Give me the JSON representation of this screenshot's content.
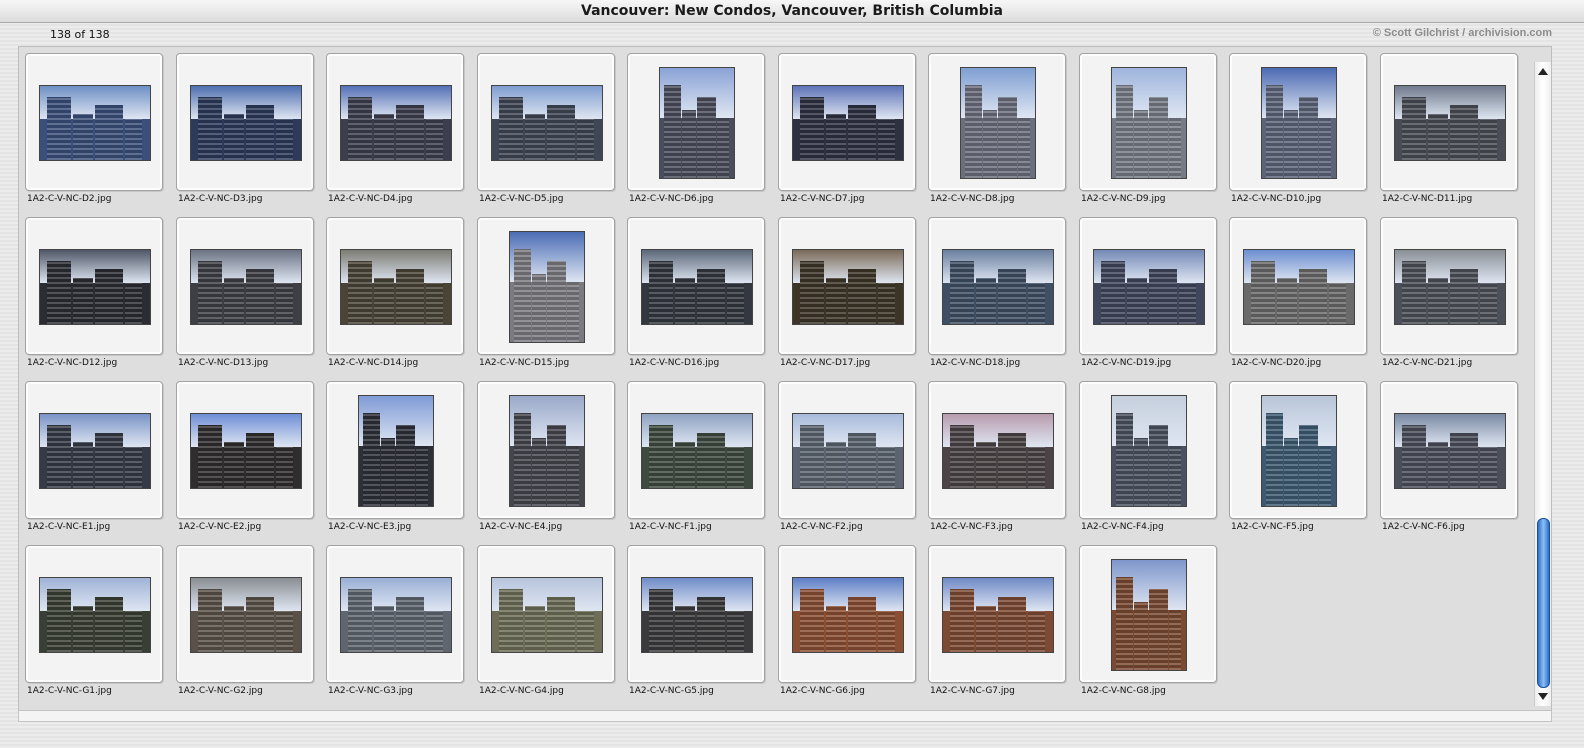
{
  "window": {
    "title": "Vancouver: New Condos, Vancouver, British Columbia"
  },
  "header": {
    "count": "138 of 138",
    "credit": "© Scott Gilchrist / archivision.com"
  },
  "items": [
    {
      "label": "1A2-C-V-NC-D2.jpg",
      "orientation": "landscape",
      "sky": "#6d8fc4",
      "tone": "#3a4f7a"
    },
    {
      "label": "1A2-C-V-NC-D3.jpg",
      "orientation": "landscape",
      "sky": "#4d6fb0",
      "tone": "#2d3a5a"
    },
    {
      "label": "1A2-C-V-NC-D4.jpg",
      "orientation": "landscape",
      "sky": "#5470b5",
      "tone": "#3c3e4e"
    },
    {
      "label": "1A2-C-V-NC-D5.jpg",
      "orientation": "landscape",
      "sky": "#7f9dd0",
      "tone": "#3f4654"
    },
    {
      "label": "1A2-C-V-NC-D6.jpg",
      "orientation": "portrait",
      "sky": "#8aa3d6",
      "tone": "#4a4e5c"
    },
    {
      "label": "1A2-C-V-NC-D7.jpg",
      "orientation": "landscape",
      "sky": "#5d73b8",
      "tone": "#2e3142"
    },
    {
      "label": "1A2-C-V-NC-D8.jpg",
      "orientation": "portrait",
      "sky": "#7f9fd2",
      "tone": "#6b6f7c"
    },
    {
      "label": "1A2-C-V-NC-D9.jpg",
      "orientation": "portrait",
      "sky": "#9eb4dd",
      "tone": "#767b86"
    },
    {
      "label": "1A2-C-V-NC-D10.jpg",
      "orientation": "portrait",
      "sky": "#4d6bb3",
      "tone": "#5c6479"
    },
    {
      "label": "1A2-C-V-NC-D11.jpg",
      "orientation": "landscape",
      "sky": "#6f7a8c",
      "tone": "#494c55"
    },
    {
      "label": "1A2-C-V-NC-D12.jpg",
      "orientation": "landscape",
      "sky": "#4f5768",
      "tone": "#2b2d33"
    },
    {
      "label": "1A2-C-V-NC-D13.jpg",
      "orientation": "landscape",
      "sky": "#6b7283",
      "tone": "#3d3f45"
    },
    {
      "label": "1A2-C-V-NC-D14.jpg",
      "orientation": "landscape",
      "sky": "#7d7c74",
      "tone": "#4a4437"
    },
    {
      "label": "1A2-C-V-NC-D15.jpg",
      "orientation": "portrait",
      "sky": "#4b6db4",
      "tone": "#7a7a80"
    },
    {
      "label": "1A2-C-V-NC-D16.jpg",
      "orientation": "landscape",
      "sky": "#5b6778",
      "tone": "#33373f"
    },
    {
      "label": "1A2-C-V-NC-D17.jpg",
      "orientation": "landscape",
      "sky": "#7a6a58",
      "tone": "#3c3528"
    },
    {
      "label": "1A2-C-V-NC-D18.jpg",
      "orientation": "landscape",
      "sky": "#6a7f9f",
      "tone": "#3f4f64"
    },
    {
      "label": "1A2-C-V-NC-D19.jpg",
      "orientation": "landscape",
      "sky": "#7489b6",
      "tone": "#40475c"
    },
    {
      "label": "1A2-C-V-NC-D20.jpg",
      "orientation": "landscape",
      "sky": "#6d8fd0",
      "tone": "#6a6a6a"
    },
    {
      "label": "1A2-C-V-NC-D21.jpg",
      "orientation": "landscape",
      "sky": "#8a8f96",
      "tone": "#4c5058"
    },
    {
      "label": "1A2-C-V-NC-E1.jpg",
      "orientation": "landscape",
      "sky": "#7a93c6",
      "tone": "#353a46"
    },
    {
      "label": "1A2-C-V-NC-E2.jpg",
      "orientation": "landscape",
      "sky": "#6f8fd6",
      "tone": "#2f2d2d"
    },
    {
      "label": "1A2-C-V-NC-E3.jpg",
      "orientation": "portrait",
      "sky": "#7f9bd6",
      "tone": "#2e3038"
    },
    {
      "label": "1A2-C-V-NC-E4.jpg",
      "orientation": "portrait",
      "sky": "#9aa9c9",
      "tone": "#44464e"
    },
    {
      "label": "1A2-C-V-NC-F1.jpg",
      "orientation": "landscape",
      "sky": "#8fa3c2",
      "tone": "#3e4a3f"
    },
    {
      "label": "1A2-C-V-NC-F2.jpg",
      "orientation": "landscape",
      "sky": "#a8bbdc",
      "tone": "#5b6470"
    },
    {
      "label": "1A2-C-V-NC-F3.jpg",
      "orientation": "landscape",
      "sky": "#b79cae",
      "tone": "#4b4345"
    },
    {
      "label": "1A2-C-V-NC-F4.jpg",
      "orientation": "portrait",
      "sky": "#c6cfdd",
      "tone": "#4b5160"
    },
    {
      "label": "1A2-C-V-NC-F5.jpg",
      "orientation": "portrait",
      "sky": "#b9c6d9",
      "tone": "#3e5a72"
    },
    {
      "label": "1A2-C-V-NC-F6.jpg",
      "orientation": "landscape",
      "sky": "#7a8aa3",
      "tone": "#4b4f5a"
    },
    {
      "label": "1A2-C-V-NC-G1.jpg",
      "orientation": "landscape",
      "sky": "#9fb3d6",
      "tone": "#3a3f35"
    },
    {
      "label": "1A2-C-V-NC-G2.jpg",
      "orientation": "landscape",
      "sky": "#8a8e92",
      "tone": "#5a5249"
    },
    {
      "label": "1A2-C-V-NC-G3.jpg",
      "orientation": "landscape",
      "sky": "#9aafd6",
      "tone": "#5f6670"
    },
    {
      "label": "1A2-C-V-NC-G4.jpg",
      "orientation": "landscape",
      "sky": "#b6c4dc",
      "tone": "#6d6d58"
    },
    {
      "label": "1A2-C-V-NC-G5.jpg",
      "orientation": "landscape",
      "sky": "#6f8cc8",
      "tone": "#3b3a3c"
    },
    {
      "label": "1A2-C-V-NC-G6.jpg",
      "orientation": "landscape",
      "sky": "#5f7fc6",
      "tone": "#8a4e33"
    },
    {
      "label": "1A2-C-V-NC-G7.jpg",
      "orientation": "landscape",
      "sky": "#6f8ac6",
      "tone": "#7d4b34"
    },
    {
      "label": "1A2-C-V-NC-G8.jpg",
      "orientation": "portrait",
      "sky": "#7f96cc",
      "tone": "#7a4a33"
    }
  ]
}
